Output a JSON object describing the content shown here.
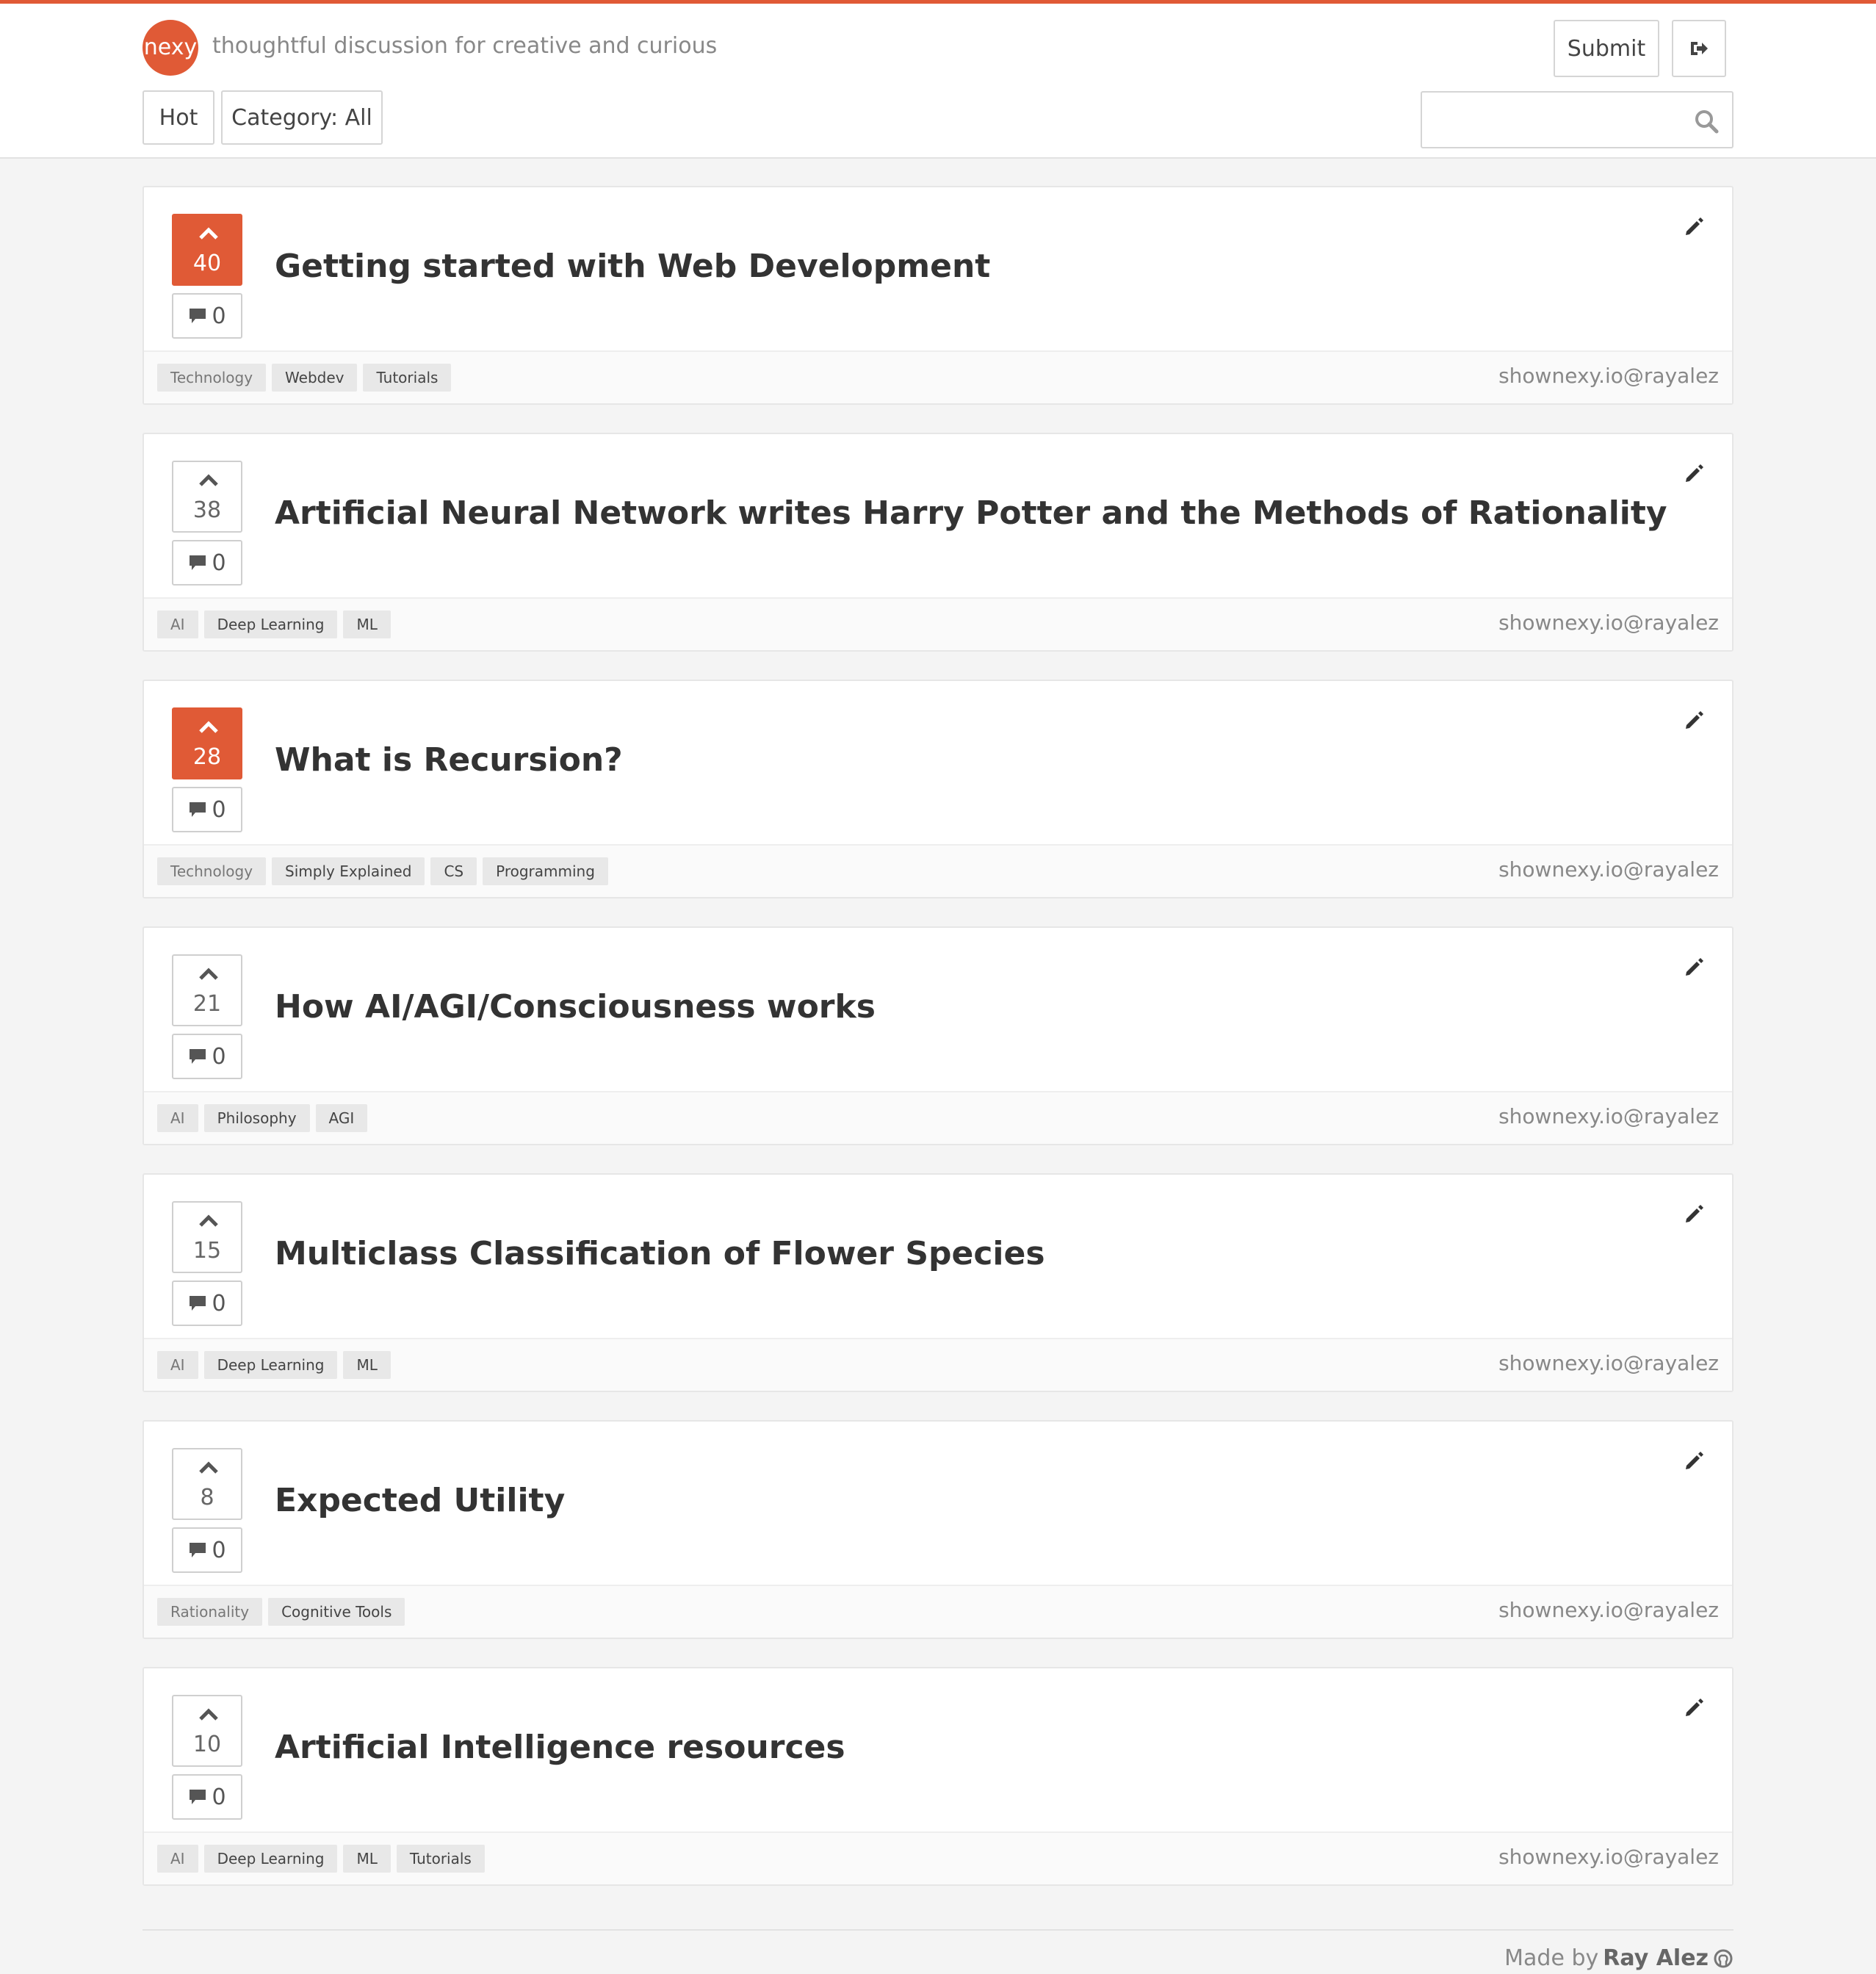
{
  "header": {
    "logo_text": "nexy",
    "tagline": "thoughtful discussion for creative and curious",
    "submit_label": "Submit",
    "hot_label": "Hot",
    "category_label": "Category: All",
    "search_placeholder": ""
  },
  "posts": [
    {
      "votes": "40",
      "voted": true,
      "comments": "0",
      "title": "Getting started with Web Development",
      "tags": [
        "Technology",
        "Webdev",
        "Tutorials"
      ],
      "source": "shownexy.io@rayalez"
    },
    {
      "votes": "38",
      "voted": false,
      "comments": "0",
      "title": "Artificial Neural Network writes Harry Potter and the Methods of Rationality",
      "tags": [
        "AI",
        "Deep Learning",
        "ML"
      ],
      "source": "shownexy.io@rayalez"
    },
    {
      "votes": "28",
      "voted": true,
      "comments": "0",
      "title": "What is Recursion?",
      "tags": [
        "Technology",
        "Simply Explained",
        "CS",
        "Programming"
      ],
      "source": "shownexy.io@rayalez"
    },
    {
      "votes": "21",
      "voted": false,
      "comments": "0",
      "title": "How AI/AGI/Consciousness works",
      "tags": [
        "AI",
        "Philosophy",
        "AGI"
      ],
      "source": "shownexy.io@rayalez"
    },
    {
      "votes": "15",
      "voted": false,
      "comments": "0",
      "title": "Multiclass Classification of Flower Species",
      "tags": [
        "AI",
        "Deep Learning",
        "ML"
      ],
      "source": "shownexy.io@rayalez"
    },
    {
      "votes": "8",
      "voted": false,
      "comments": "0",
      "title": "Expected Utility",
      "tags": [
        "Rationality",
        "Cognitive Tools"
      ],
      "source": "shownexy.io@rayalez"
    },
    {
      "votes": "10",
      "voted": false,
      "comments": "0",
      "title": "Artificial Intelligence resources",
      "tags": [
        "AI",
        "Deep Learning",
        "ML",
        "Tutorials"
      ],
      "source": "shownexy.io@rayalez"
    }
  ],
  "footer": {
    "made_by_prefix": "Made by",
    "author": "Ray Alez"
  },
  "icons": {
    "logout": "sign-out-icon",
    "search": "search-icon",
    "upvote": "chevron-up-icon",
    "comment": "comment-icon",
    "edit": "pencil-icon",
    "github": "github-icon"
  },
  "colors": {
    "accent": "#e05a36",
    "background": "#f4f4f4"
  }
}
